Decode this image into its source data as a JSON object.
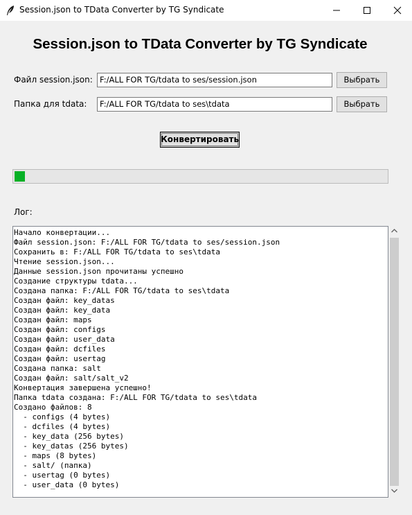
{
  "window": {
    "title": "Session.json to TData Converter by TG Syndicate"
  },
  "header": {
    "title": "Session.json to TData Converter by TG Syndicate"
  },
  "form": {
    "session_label": "Файл session.json:",
    "session_value": "F:/ALL FOR TG/tdata to ses/session.json",
    "tdata_label": "Папка для tdata:",
    "tdata_value": "F:/ALL FOR TG/tdata to ses\\tdata",
    "browse_label_1": "Выбрать",
    "browse_label_2": "Выбрать"
  },
  "convert_button": "Конвертировать",
  "progress": {
    "value": 0.028,
    "color": "#06b025"
  },
  "log": {
    "label": "Лог:",
    "lines": [
      "Начало конвертации...",
      "Файл session.json: F:/ALL FOR TG/tdata to ses/session.json",
      "Сохранить в: F:/ALL FOR TG/tdata to ses\\tdata",
      "Чтение session.json...",
      "Данные session.json прочитаны успешно",
      "Создание структуры tdata...",
      "Создана папка: F:/ALL FOR TG/tdata to ses\\tdata",
      "Создан файл: key_datas",
      "Создан файл: key_data",
      "Создан файл: maps",
      "Создан файл: configs",
      "Создан файл: user_data",
      "Создан файл: dcfiles",
      "Создан файл: usertag",
      "Создана папка: salt",
      "Создан файл: salt/salt_v2",
      "Конвертация завершена успешно!",
      "Папка tdata создана: F:/ALL FOR TG/tdata to ses\\tdata",
      "Создано файлов: 8",
      "  - configs (4 bytes)",
      "  - dcfiles (4 bytes)",
      "  - key_data (256 bytes)",
      "  - key_datas (256 bytes)",
      "  - maps (8 bytes)",
      "  - salt/ (папка)",
      "  - usertag (0 bytes)",
      "  - user_data (0 bytes)"
    ]
  },
  "icons": {
    "app": "feather-icon",
    "minimize": "minimize-icon",
    "maximize": "maximize-icon",
    "close": "close-icon"
  }
}
